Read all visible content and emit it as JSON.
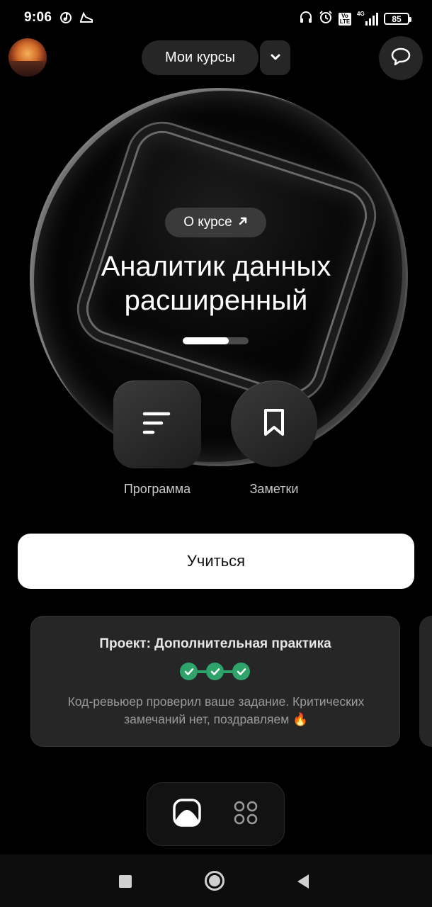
{
  "status_bar": {
    "time": "9:06",
    "battery": "85",
    "network_badge": "4G",
    "volte_badge": "Vo LTE",
    "icons": [
      "music-note-icon",
      "sneaker-icon",
      "headphones-icon",
      "alarm-icon",
      "volte-icon",
      "signal-icon",
      "battery-icon"
    ]
  },
  "header": {
    "courses_label": "Мои курсы",
    "icons": [
      "avatar",
      "chevron-down-icon",
      "chat-bubble-icon"
    ]
  },
  "course": {
    "about_label": "О курсе",
    "title_line1": "Аналитик данных",
    "title_line2": "расширенный",
    "progress_fraction": 0.7
  },
  "actions": {
    "program_label": "Программа",
    "notes_label": "Заметки",
    "learn_label": "Учиться"
  },
  "project_card": {
    "title": "Проект: Дополнительная практика",
    "checks_completed": 3,
    "description_line1": "Код-ревьюер проверил ваше задание. Критических",
    "description_line2": "замечаний нет, поздравляем 🔥"
  },
  "bottom_tabs": {
    "items": [
      "course-view-icon",
      "grid-icon"
    ],
    "active": "course-view-icon"
  },
  "colors": {
    "background": "#000000",
    "accent_green": "#2ea36a",
    "card_bg": "#262626",
    "button_white": "#ffffff"
  }
}
